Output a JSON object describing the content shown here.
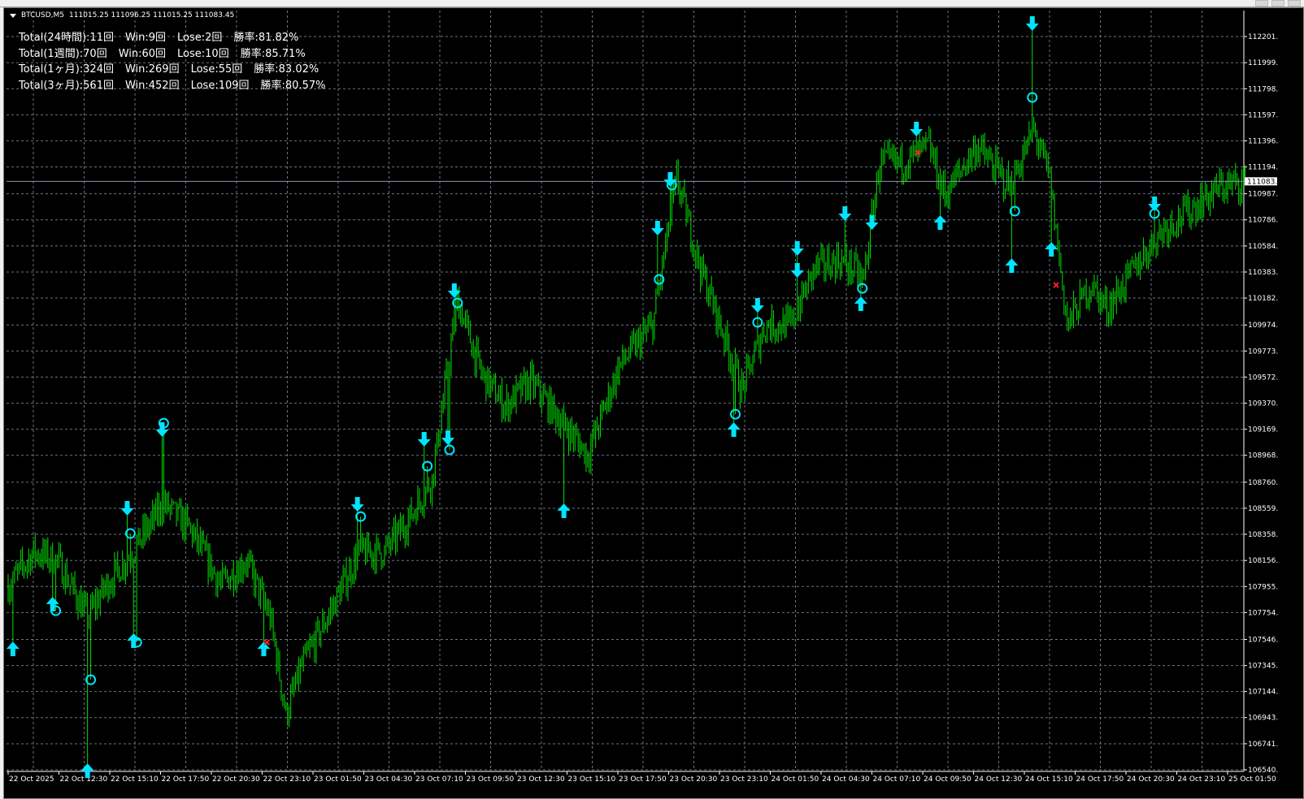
{
  "window": {
    "symbol_header": "BTCUSD,M5",
    "ohlc": "111015.25 111096.25 111015.25 111083.45"
  },
  "stats": [
    {
      "total": "Total(24時間):11回",
      "win": "Win:9回",
      "lose": "Lose:2回",
      "rate": "勝率:81.82%"
    },
    {
      "total": "Total(1週間):70回",
      "win": "Win:60回",
      "lose": "Lose:10回",
      "rate": "勝率:85.71%"
    },
    {
      "total": "Total(1ヶ月):324回",
      "win": "Win:269回",
      "lose": "Lose:55回",
      "rate": "勝率:83.02%"
    },
    {
      "total": "Total(3ヶ月):561回",
      "win": "Win:452回",
      "lose": "Lose:109回",
      "rate": "勝率:80.57%"
    }
  ],
  "colors": {
    "bars": "#00e000",
    "signal": "#00e5ff",
    "lose": "#ff2020",
    "grid": "#6a7585",
    "background": "#000000"
  },
  "chart_data": {
    "type": "bar",
    "symbol": "BTCUSD",
    "timeframe": "M5",
    "current_price": "111083.",
    "ylim": [
      106540,
      112201
    ],
    "y_ticks": [
      "112201.",
      "111999.",
      "111798.",
      "111597.",
      "111396.",
      "111194.",
      "110987.",
      "110786.",
      "110584.",
      "110383.",
      "110182.",
      "109974.",
      "109773.",
      "109572.",
      "109370.",
      "109169.",
      "108968.",
      "108760.",
      "108559.",
      "108358.",
      "108156.",
      "107955.",
      "107754.",
      "107546.",
      "107345.",
      "107144.",
      "106943.",
      "106741.",
      "106540."
    ],
    "y_tick_values": [
      112201,
      111999,
      111798,
      111597,
      111396,
      111194,
      110987,
      110786,
      110584,
      110383,
      110182,
      109974,
      109773,
      109572,
      109370,
      109169,
      108968,
      108760,
      108559,
      108358,
      108156,
      107955,
      107754,
      107546,
      107345,
      107144,
      106943,
      106741,
      106540
    ],
    "x_ticks": [
      "22 Oct 2025",
      "22 Oct 12:30",
      "22 Oct 15:10",
      "22 Oct 17:50",
      "22 Oct 20:30",
      "22 Oct 23:10",
      "23 Oct 01:50",
      "23 Oct 04:30",
      "23 Oct 07:10",
      "23 Oct 09:50",
      "23 Oct 12:30",
      "23 Oct 15:10",
      "23 Oct 17:50",
      "23 Oct 20:30",
      "23 Oct 23:10",
      "24 Oct 01:50",
      "24 Oct 04:30",
      "24 Oct 07:10",
      "24 Oct 09:50",
      "24 Oct 12:30",
      "24 Oct 15:10",
      "24 Oct 17:50",
      "24 Oct 20:30",
      "24 Oct 23:10",
      "25 Oct 01:50"
    ],
    "bars_per_x_tick": 32,
    "total_bars": 780,
    "price_path": [
      [
        1,
        107969
      ],
      [
        16,
        108220
      ],
      [
        31,
        108157
      ],
      [
        50,
        107718
      ],
      [
        62,
        107969
      ],
      [
        78,
        108220
      ],
      [
        98,
        108596
      ],
      [
        114,
        108408
      ],
      [
        134,
        107969
      ],
      [
        150,
        108157
      ],
      [
        165,
        107718
      ],
      [
        175,
        106965
      ],
      [
        185,
        107342
      ],
      [
        201,
        107718
      ],
      [
        221,
        108220
      ],
      [
        237,
        108220
      ],
      [
        252,
        108470
      ],
      [
        267,
        108784
      ],
      [
        283,
        110163
      ],
      [
        298,
        109599
      ],
      [
        313,
        109348
      ],
      [
        329,
        109536
      ],
      [
        349,
        109223
      ],
      [
        365,
        108972
      ],
      [
        385,
        109662
      ],
      [
        406,
        109975
      ],
      [
        421,
        111104
      ],
      [
        436,
        110414
      ],
      [
        452,
        109850
      ],
      [
        462,
        109474
      ],
      [
        477,
        109975
      ],
      [
        493,
        109975
      ],
      [
        508,
        110414
      ],
      [
        523,
        110477
      ],
      [
        539,
        110351
      ],
      [
        549,
        111229
      ],
      [
        564,
        111229
      ],
      [
        580,
        111355
      ],
      [
        590,
        110978
      ],
      [
        610,
        111355
      ],
      [
        631,
        111041
      ],
      [
        646,
        111480
      ],
      [
        656,
        111104
      ],
      [
        667,
        109975
      ],
      [
        682,
        110288
      ],
      [
        692,
        110100
      ],
      [
        713,
        110477
      ],
      [
        728,
        110727
      ],
      [
        743,
        110853
      ],
      [
        764,
        111041
      ],
      [
        779,
        111083
      ]
    ],
    "signals": {
      "buy_arrows": [
        [
          3,
          107530
        ],
        [
          28,
          107875
        ],
        [
          50,
          106589
        ],
        [
          79,
          107593
        ],
        [
          161,
          107530
        ],
        [
          350,
          108596
        ],
        [
          457,
          109223
        ],
        [
          537,
          110195
        ],
        [
          587,
          110822
        ],
        [
          632,
          110489
        ],
        [
          657,
          110615
        ]
      ],
      "sell_arrows": [
        [
          75,
          108502
        ],
        [
          97,
          109110
        ],
        [
          220,
          108533
        ],
        [
          262,
          109035
        ],
        [
          277,
          109047
        ],
        [
          281,
          110182
        ],
        [
          409,
          110665
        ],
        [
          417,
          111041
        ],
        [
          472,
          110069
        ],
        [
          497,
          110508
        ],
        [
          497,
          110339
        ],
        [
          527,
          110778
        ],
        [
          544,
          110709
        ],
        [
          572,
          111430
        ],
        [
          645,
          112245
        ],
        [
          722,
          110853
        ]
      ],
      "win_circles": [
        [
          30,
          107768
        ],
        [
          52,
          107235
        ],
        [
          77,
          108364
        ],
        [
          81,
          107524
        ],
        [
          98,
          109216
        ],
        [
          222,
          108495
        ],
        [
          264,
          108884
        ],
        [
          278,
          109010
        ],
        [
          283,
          110144
        ],
        [
          410,
          110326
        ],
        [
          418,
          111054
        ],
        [
          458,
          109285
        ],
        [
          472,
          109994
        ],
        [
          538,
          110257
        ],
        [
          634,
          110853
        ],
        [
          645,
          111731
        ],
        [
          722,
          110834
        ]
      ],
      "lose_crosses": [
        [
          163,
          107524
        ],
        [
          573,
          111304
        ],
        [
          660,
          110282
        ]
      ]
    }
  }
}
